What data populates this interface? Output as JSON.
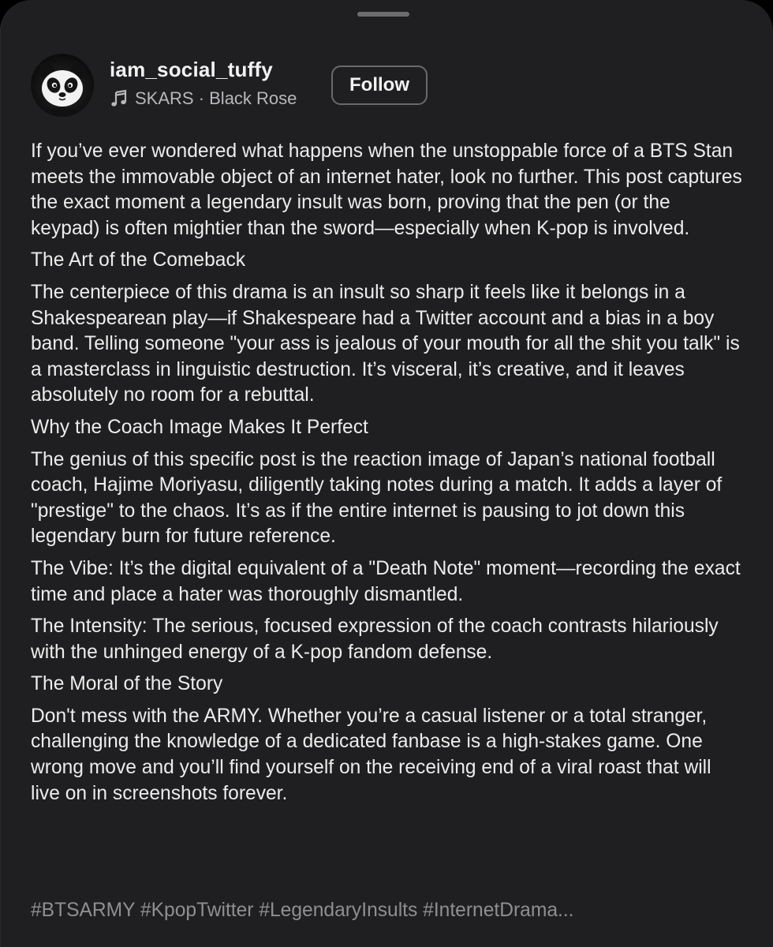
{
  "post": {
    "username": "iam_social_tuffy",
    "music": "SKARS · Black Rose",
    "follow_label": "Follow",
    "paragraphs": [
      "If you’ve ever wondered what happens when the unstoppable force of a BTS Stan meets the immovable object of an internet hater, look no further. This post captures the exact moment a legendary insult was born, proving that the pen (or the keypad) is often mightier than the sword—especially when K-pop is involved.",
      "The Art of the Comeback",
      "The centerpiece of this drama is an insult so sharp it feels like it belongs in a Shakespearean play—if Shakespeare had a Twitter account and a bias in a boy band. Telling someone \"your ass is jealous of your mouth for all the shit you talk\" is a masterclass in linguistic destruction. It’s visceral, it’s creative, and it leaves absolutely no room for a rebuttal.",
      "Why the Coach Image Makes It Perfect",
      "The genius of this specific post is the reaction image of Japan’s national football coach, Hajime Moriyasu, diligently taking notes during a match. It adds a layer of \"prestige\" to the chaos. It’s as if the entire internet is pausing to jot down this legendary burn for future reference.",
      "The Vibe: It’s the digital equivalent of a \"Death Note\" moment—recording the exact time and place a hater was thoroughly dismantled.",
      "The Intensity: The serious, focused expression of the coach contrasts hilariously with the unhinged energy of a K-pop fandom defense.",
      "The Moral of the Story",
      "Don't mess with the ARMY. Whether you’re a casual listener or a total stranger, challenging the knowledge of a dedicated fanbase is a high-stakes game. One wrong move and you’ll find yourself on the receiving end of a viral roast that will live on in screenshots forever."
    ],
    "hashtags": "#BTSARMY #KpopTwitter #LegendaryInsults #InternetDrama..."
  },
  "icons": {
    "avatar": "panda-avatar-icon",
    "music": "music-note-icon"
  },
  "colors": {
    "sheet_background": "#1f1f21",
    "primary_text": "#ececec",
    "secondary_text": "#b8b8bc",
    "hashtag_text": "#8f8f93",
    "follow_border": "#6a6a6e"
  }
}
